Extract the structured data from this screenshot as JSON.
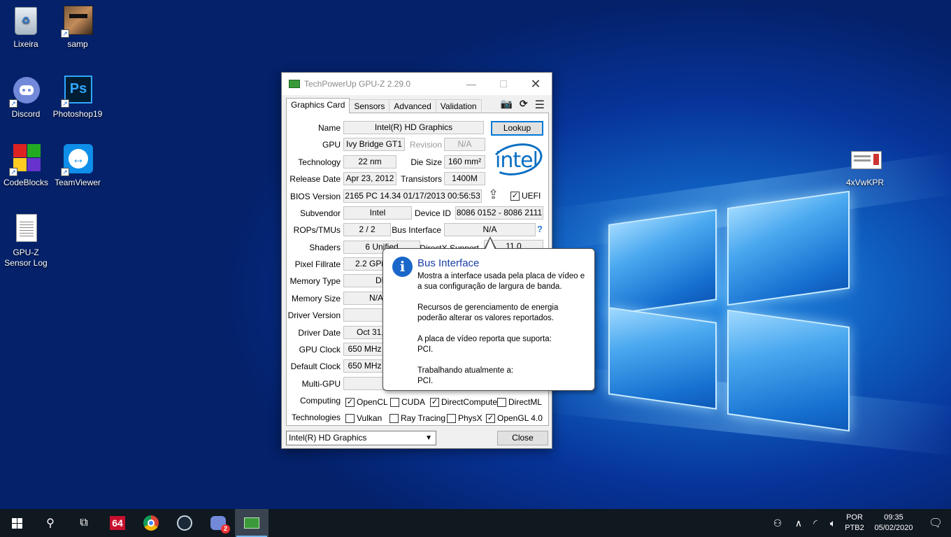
{
  "desktop": {
    "icons": [
      {
        "label": "Lixeira",
        "icon": "recycle-bin-icon"
      },
      {
        "label": "samp",
        "icon": "samp-icon"
      },
      {
        "label": "Discord",
        "icon": "discord-icon"
      },
      {
        "label": "Photoshop19",
        "icon": "photoshop-icon"
      },
      {
        "label": "CodeBlocks",
        "icon": "codeblocks-icon"
      },
      {
        "label": "TeamViewer",
        "icon": "teamviewer-icon"
      },
      {
        "label": "GPU-Z\nSensor Log",
        "icon": "text-file-icon"
      },
      {
        "label": "4xVwKPR",
        "icon": "image-file-icon"
      }
    ]
  },
  "window": {
    "title": "TechPowerUp GPU-Z 2.29.0",
    "tabs": [
      "Graphics Card",
      "Sensors",
      "Advanced",
      "Validation"
    ],
    "fields": {
      "name_label": "Name",
      "name": "Intel(R) HD Graphics",
      "lookup": "Lookup",
      "gpu_label": "GPU",
      "gpu": "Ivy Bridge GT1",
      "revision_label": "Revision",
      "revision": "N/A",
      "technology_label": "Technology",
      "technology": "22 nm",
      "die_label": "Die Size",
      "die": "160 mm²",
      "release_label": "Release Date",
      "release": "Apr 23, 2012",
      "transistors_label": "Transistors",
      "transistors": "1400M",
      "bios_label": "BIOS Version",
      "bios": "2165 PC 14.34 01/17/2013 00:56:53",
      "uefi": "UEFI",
      "subvendor_label": "Subvendor",
      "subvendor": "Intel",
      "device_label": "Device ID",
      "device": "8086 0152 - 8086 2111",
      "rops_label": "ROPs/TMUs",
      "rops": "2 / 2",
      "bus_label": "Bus Interface",
      "bus": "N/A",
      "help": "?",
      "shaders_label": "Shaders",
      "shaders": "6 Unified",
      "directx_label": "DirectX Support",
      "directx": "11.0",
      "pixel_label": "Pixel Fillrate",
      "pixel": "2.2 GPix",
      "memtype_label": "Memory Type",
      "memtype": "DD",
      "memsize_label": "Memory Size",
      "memsize": "N/A",
      "driverver_label": "Driver Version",
      "driverver": "",
      "driverdate_label": "Driver Date",
      "driverdate": "Oct 31,",
      "gpuclock_label": "GPU Clock",
      "gpuclock": "650 MHz",
      "defclock_label": "Default Clock",
      "defclock": "650 MHz",
      "multigpu_label": "Multi-GPU",
      "multigpu": "",
      "computing_label": "Computing",
      "technologies_label": "Technologies"
    },
    "computing": [
      {
        "label": "OpenCL",
        "checked": true
      },
      {
        "label": "CUDA",
        "checked": false
      },
      {
        "label": "DirectCompute",
        "checked": true
      },
      {
        "label": "DirectML",
        "checked": false
      }
    ],
    "technologies": [
      {
        "label": "Vulkan",
        "checked": false
      },
      {
        "label": "Ray Tracing",
        "checked": false
      },
      {
        "label": "PhysX",
        "checked": false
      },
      {
        "label": "OpenGL 4.0",
        "checked": true
      }
    ],
    "gpu_select": "Intel(R) HD Graphics",
    "close": "Close",
    "logo": "intel"
  },
  "tooltip": {
    "title": "Bus Interface",
    "p1": "Mostra a interface usada pela placa de vídeo e\na sua configuração de largura de banda.",
    "p2": "Recursos de gerenciamento de energia\npoderão alterar os valores reportados.",
    "p3": "A placa de vídeo reporta que suporta:\nPCI.",
    "p4": "Trabalhando atualmente a:\nPCI."
  },
  "taskbar": {
    "app64": "64",
    "discord_badge": "2",
    "lang1": "POR",
    "lang2": "PTB2",
    "time": "09:35",
    "date": "05/02/2020"
  }
}
